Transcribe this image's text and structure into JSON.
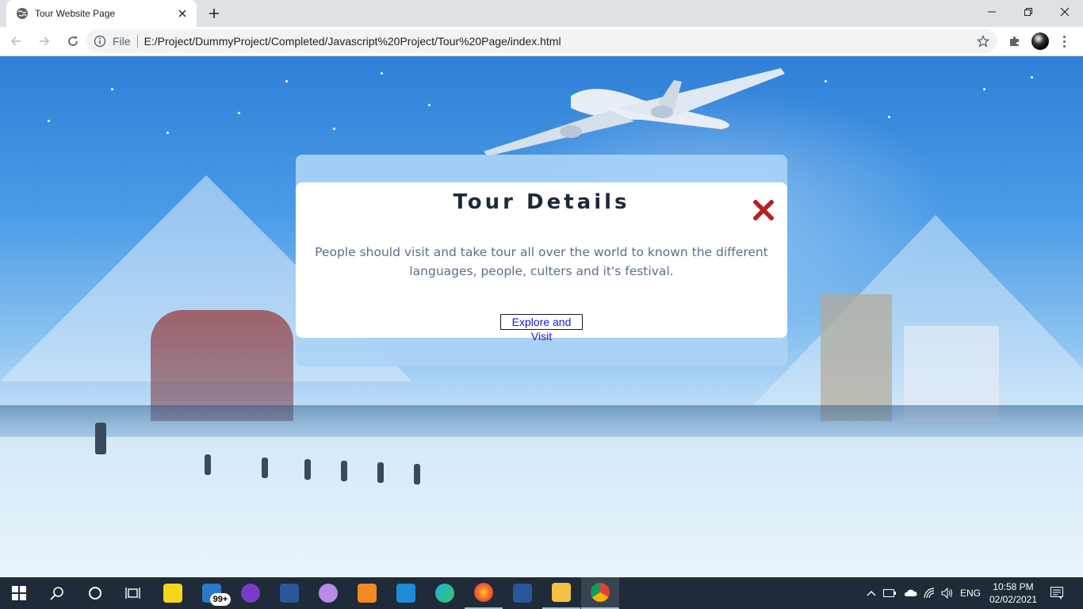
{
  "browser": {
    "tab_title": "Tour Website Page",
    "url_scheme": "File",
    "url": "E:/Project/DummyProject/Completed/Javascript%20Project/Tour%20Page/index.html"
  },
  "modal": {
    "title": "Tour Details",
    "text": "People should visit and take tour all over the world to known the different languages, people, culters and it's festival.",
    "button_label": "Explore and Visit",
    "close_color": "#b22222"
  },
  "taskbar": {
    "apps": [
      "start-icon",
      "search-icon",
      "cortana-icon",
      "task-view-icon",
      "player-app-icon",
      "mail-app-icon",
      "podcast-app-icon",
      "word-app-icon",
      "cat-app-icon",
      "sublime-app-icon",
      "vscode-app-icon",
      "edge-app-icon",
      "firefox-app-icon",
      "word2-app-icon",
      "file-explorer-icon",
      "chrome-app-icon"
    ],
    "mail_badge": "99+",
    "language": "ENG",
    "time": "10:58 PM",
    "date": "02/02/2021"
  }
}
